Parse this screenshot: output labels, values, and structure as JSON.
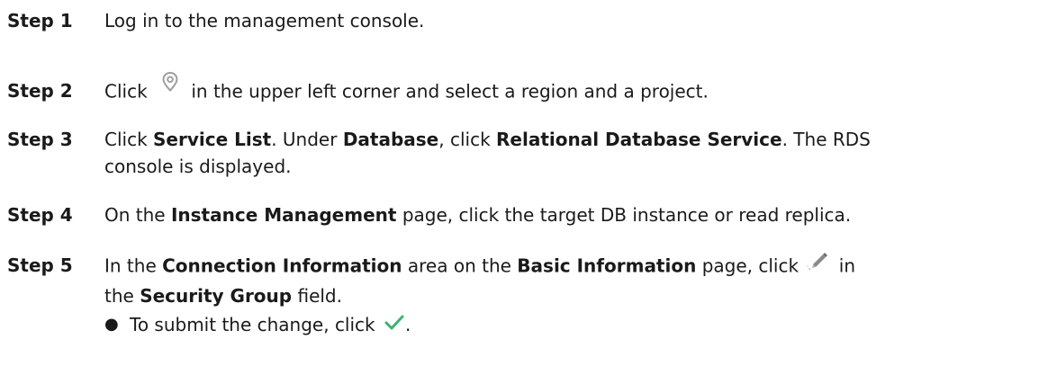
{
  "steps": [
    {
      "label": "Step 1",
      "text": "Log in to the management console."
    },
    {
      "label": "Step 2",
      "t1": "Click",
      "icon": "location-pin-icon",
      "t2": "in the upper left corner and select a region and a project."
    },
    {
      "label": "Step 3",
      "t1": "Click",
      "b1": "Service List",
      "t2": ". Under",
      "b2": "Database",
      "t3": ", click",
      "b3": "Relational Database Service",
      "t4": ". The RDS",
      "t5": "console is displayed."
    },
    {
      "label": "Step 4",
      "t1": "On the",
      "b1": "Instance Management",
      "t2": "page, click the target DB instance or read replica."
    },
    {
      "label": "Step 5",
      "t1": "In the",
      "b1": "Connection Information",
      "t2": "area on the",
      "b2": "Basic Information",
      "t3": "page, click",
      "icon": "edit-pencil-icon",
      "t4": "in",
      "t5": "the",
      "b3": "Security Group",
      "t6": "field."
    }
  ],
  "bullets": [
    {
      "text": "To submit the change, click",
      "icon": "checkmark-icon",
      "tail": "."
    }
  ],
  "colors": {
    "text": "#1a1a1a",
    "pin_icon": "#9e9e9e",
    "pencil_icon": "#8a8a8a",
    "check_icon": "#3cb371"
  }
}
